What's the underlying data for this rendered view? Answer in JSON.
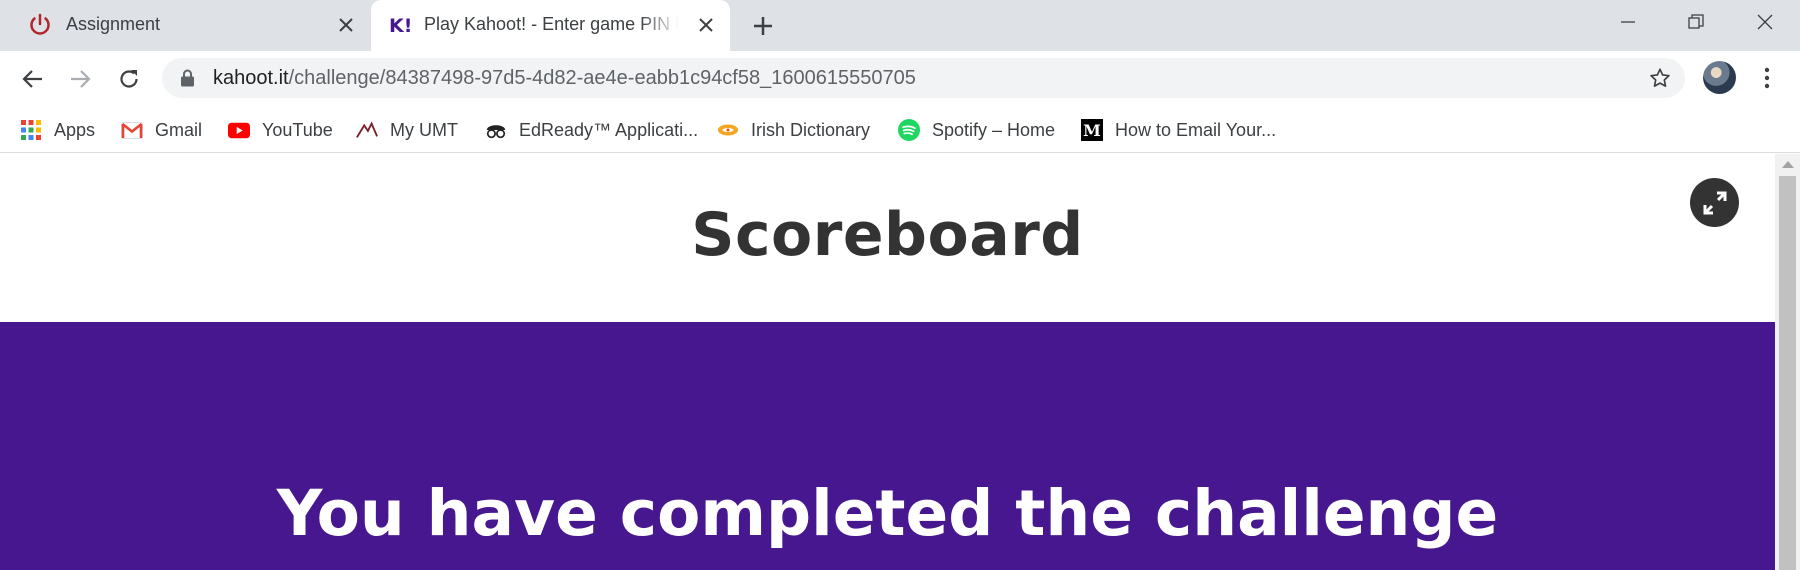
{
  "tabs": [
    {
      "title": "Assignment",
      "favicon": "power-icon",
      "active": false
    },
    {
      "title": "Play Kahoot! - Enter game PIN here!",
      "favicon": "kahoot-icon",
      "active": true
    }
  ],
  "toolbar": {
    "url_host": "kahoot.it",
    "url_path": "/challenge/84387498-97d5-4d82-ae4e-eabb1c94cf58_1600615550705"
  },
  "bookmarks": [
    {
      "label": "Apps",
      "icon": "apps-grid-icon"
    },
    {
      "label": "Gmail",
      "icon": "gmail-icon"
    },
    {
      "label": "YouTube",
      "icon": "youtube-icon"
    },
    {
      "label": "My UMT",
      "icon": "umt-icon"
    },
    {
      "label": "EdReady™ Applicati...",
      "icon": "edready-icon"
    },
    {
      "label": "Irish Dictionary",
      "icon": "dictionary-icon"
    },
    {
      "label": "Spotify – Home",
      "icon": "spotify-icon"
    },
    {
      "label": "How to Email Your...",
      "icon": "medium-icon"
    }
  ],
  "page": {
    "title": "Scoreboard",
    "heading": "You have completed the challenge"
  },
  "colors": {
    "kahoot_purple": "#46178f",
    "tabstrip": "#dee1e6",
    "omnibox": "#f1f3f4"
  }
}
